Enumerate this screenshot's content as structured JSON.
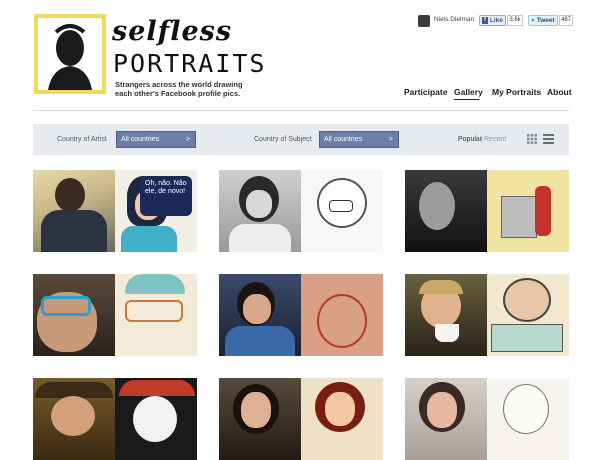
{
  "logo": {
    "word1": "selfless",
    "word2": "PORTRAITS",
    "tagline": "Strangers across the world drawing each other's Facebook profile pics."
  },
  "social": {
    "user_name": "Niels Dielman",
    "fb_label": "Like",
    "fb_count": "3.6k",
    "tw_label": "Tweet",
    "tw_count": "487"
  },
  "nav": [
    {
      "label": "Participate"
    },
    {
      "label": "Gallery"
    },
    {
      "label": "My Portraits"
    },
    {
      "label": "About"
    }
  ],
  "filters": {
    "artist_label": "Country of Artist",
    "artist_value": "All countries",
    "subject_label": "Country of Subject",
    "subject_value": "All countries",
    "arrow": ">",
    "sort_popular": "Popular",
    "sort_sep": "|",
    "sort_recent": "Recent"
  },
  "gallery": {
    "bubble_text": "Oh, não. Não ele, de novo!"
  },
  "colors": {
    "frame": "#f1d95a",
    "select": "#6d7fa7",
    "filterbar": "#e7ebef"
  }
}
